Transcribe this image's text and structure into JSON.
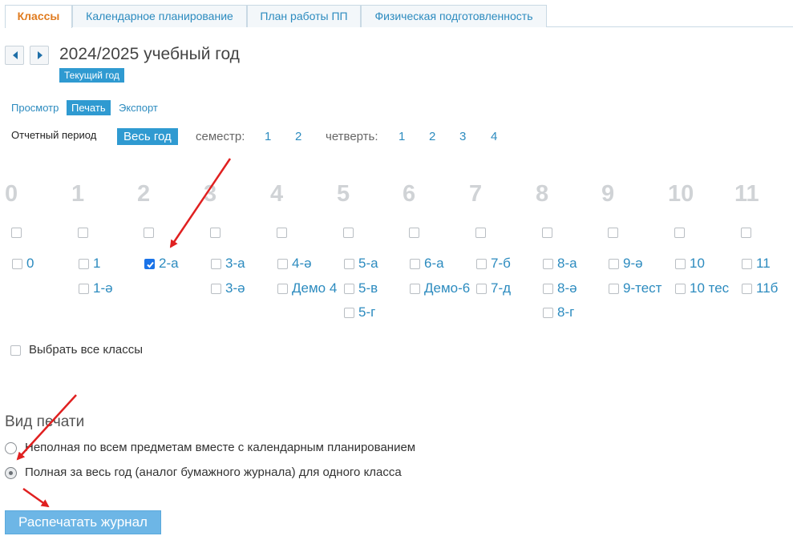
{
  "tabs": [
    "Классы",
    "Календарное планирование",
    "План работы ПП",
    "Физическая подготовленность"
  ],
  "year": {
    "title": "2024/2025 учебный год",
    "badge": "Текущий год"
  },
  "modes": [
    "Просмотр",
    "Печать",
    "Экспорт"
  ],
  "period": {
    "label": "Отчетный период",
    "all_year": "Весь год",
    "semester_label": "семестр:",
    "semesters": [
      "1",
      "2"
    ],
    "quarter_label": "четверть:",
    "quarters": [
      "1",
      "2",
      "3",
      "4"
    ]
  },
  "grades": [
    {
      "num": "0",
      "classes": [
        {
          "name": "0",
          "checked": false
        }
      ]
    },
    {
      "num": "1",
      "classes": [
        {
          "name": "1",
          "checked": false
        },
        {
          "name": "1-ә",
          "checked": false
        }
      ]
    },
    {
      "num": "2",
      "classes": [
        {
          "name": "2-а",
          "checked": true
        }
      ]
    },
    {
      "num": "3",
      "classes": [
        {
          "name": "3-а",
          "checked": false
        },
        {
          "name": "3-ә",
          "checked": false
        }
      ]
    },
    {
      "num": "4",
      "classes": [
        {
          "name": "4-ә",
          "checked": false
        },
        {
          "name": "Демо 4",
          "checked": false
        }
      ]
    },
    {
      "num": "5",
      "classes": [
        {
          "name": "5-а",
          "checked": false
        },
        {
          "name": "5-в",
          "checked": false
        },
        {
          "name": "5-г",
          "checked": false
        }
      ]
    },
    {
      "num": "6",
      "classes": [
        {
          "name": "6-а",
          "checked": false
        },
        {
          "name": "Демо-6",
          "checked": false
        }
      ]
    },
    {
      "num": "7",
      "classes": [
        {
          "name": "7-б",
          "checked": false
        },
        {
          "name": "7-д",
          "checked": false
        }
      ]
    },
    {
      "num": "8",
      "classes": [
        {
          "name": "8-а",
          "checked": false
        },
        {
          "name": "8-ә",
          "checked": false
        },
        {
          "name": "8-г",
          "checked": false
        }
      ]
    },
    {
      "num": "9",
      "classes": [
        {
          "name": "9-ә",
          "checked": false
        },
        {
          "name": "9-тест",
          "checked": false
        }
      ]
    },
    {
      "num": "10",
      "classes": [
        {
          "name": "10",
          "checked": false
        },
        {
          "name": "10 тес",
          "checked": false
        }
      ]
    },
    {
      "num": "11",
      "classes": [
        {
          "name": "11",
          "checked": false
        },
        {
          "name": "11б",
          "checked": false
        }
      ]
    }
  ],
  "select_all": {
    "label": "Выбрать все классы",
    "checked": false
  },
  "print_type": {
    "title": "Вид печати",
    "options": [
      {
        "label": "Неполная по всем предметам вместе с календарным планированием",
        "selected": false
      },
      {
        "label": "Полная за весь год (аналог бумажного журнала) для одного класса",
        "selected": true
      }
    ]
  },
  "print_button": "Распечатать журнал",
  "colors": {
    "accent": "#2f9ad1",
    "link": "#2c8bbf",
    "active_tab": "#e07b1f",
    "annotation_arrow": "#e02020"
  }
}
